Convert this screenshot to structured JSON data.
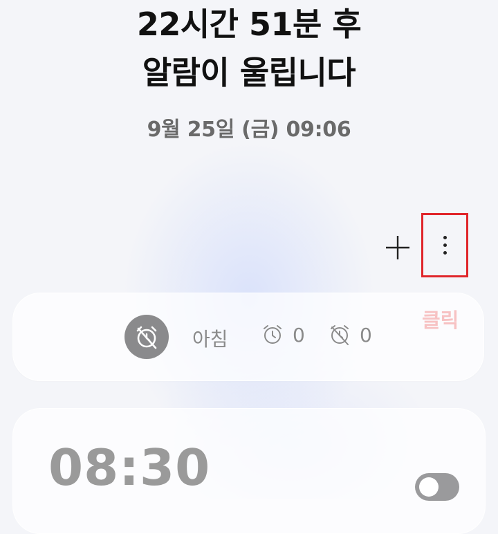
{
  "header": {
    "line1": "22시간 51분 후",
    "line2": "알람이 울립니다",
    "next_alarm_date": "9월 25일 (금) 09:06"
  },
  "toolbar": {
    "add_icon": "plus-icon",
    "more_icon": "more-vertical-icon"
  },
  "annotation": {
    "callout_text": "클릭",
    "highlight_color": "#e0252a"
  },
  "alarm_group": {
    "icon": "alarm-off-icon",
    "name": "아침",
    "active_count": "0",
    "inactive_count": "0"
  },
  "alarms": [
    {
      "time": "08:30",
      "enabled": false
    }
  ]
}
